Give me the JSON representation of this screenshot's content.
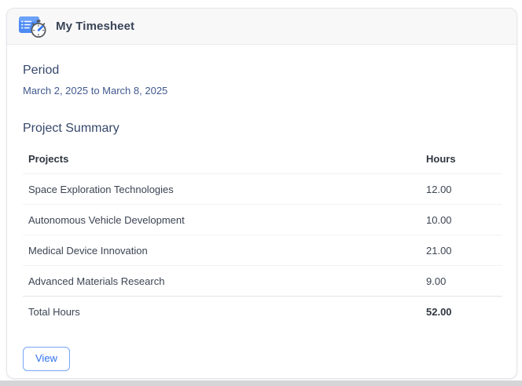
{
  "card": {
    "header": {
      "title": "My Timesheet",
      "icon": "timesheet-clock-icon"
    },
    "period": {
      "heading": "Period",
      "range": "March 2, 2025 to March 8, 2025"
    },
    "summary": {
      "heading": "Project Summary",
      "table": {
        "columns": [
          "Projects",
          "Hours"
        ],
        "rows": [
          {
            "project": "Space Exploration Technologies",
            "hours": "12.00"
          },
          {
            "project": "Autonomous Vehicle Development",
            "hours": "10.00"
          },
          {
            "project": "Medical Device Innovation",
            "hours": "21.00"
          },
          {
            "project": "Advanced Materials Research",
            "hours": "9.00"
          }
        ],
        "total": {
          "label": "Total Hours",
          "hours": "52.00"
        }
      }
    },
    "actions": {
      "view_label": "View"
    }
  },
  "colors": {
    "accent_blue": "#2d72f0",
    "icon_blue": "#4d8bf4",
    "section_heading": "#36486b",
    "date_text": "#41598f",
    "body_text": "#3b4452",
    "header_band": "#f8f8f9",
    "card_border": "#e2e5e9",
    "bottom_strip": "#d5d5d8"
  }
}
